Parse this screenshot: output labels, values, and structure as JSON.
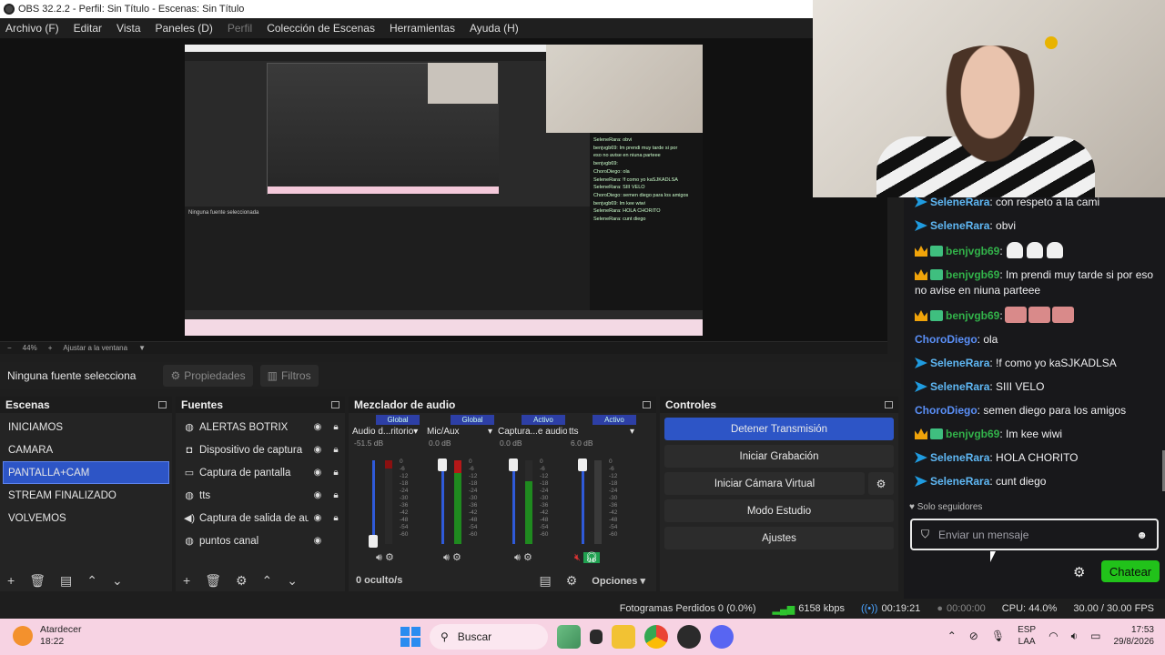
{
  "window": {
    "title": "OBS 32.2.2 - Perfil: Sin Título - Escenas: Sin Título"
  },
  "menu": [
    "Archivo (F)",
    "Editar",
    "Vista",
    "Paneles (D)",
    "Perfil",
    "Colección de Escenas",
    "Herramientas",
    "Ayuda (H)"
  ],
  "preview": {
    "zoom": "44%",
    "fit_label": "Ajustar a la ventana",
    "nested_no_source": "Ninguna fuente seleccionada",
    "mini_chat": [
      "SeleneRara: obvi",
      "benjvgb69: Im prendi muy tarde si por",
      "eso no avise en niuna parteee",
      "benjvgb69:",
      "ChoroDiego: ola",
      "SeleneRara: !f como yo kaSJKADLSA",
      "SeleneRara: SIII VELO",
      "ChoroDiego: semen diego para los amigos",
      "benjvgb69: Im kee wiwi",
      "SeleneRara: HOLA CHORITO",
      "SeleneRara: cunt diego"
    ]
  },
  "source_toolbar": {
    "no_source": "Ninguna fuente selecciona",
    "properties": "Propiedades",
    "filters": "Filtros"
  },
  "scenes": {
    "title": "Escenas",
    "items": [
      "INICIAMOS",
      "CAMARA",
      "PANTALLA+CAM",
      "STREAM FINALIZADO",
      "VOLVEMOS"
    ],
    "selected": "PANTALLA+CAM"
  },
  "sources": {
    "title": "Fuentes",
    "items": [
      {
        "icon": "globe-icon",
        "name": "ALERTAS BOTRIX"
      },
      {
        "icon": "camera-icon",
        "name": "Dispositivo de captura"
      },
      {
        "icon": "monitor-icon",
        "name": "Captura de pantalla"
      },
      {
        "icon": "globe-icon",
        "name": "tts"
      },
      {
        "icon": "speaker-icon",
        "name": "Captura de salida de audio"
      },
      {
        "icon": "globe-icon",
        "name": "puntos canal"
      }
    ]
  },
  "mixer": {
    "title": "Mezclador de audio",
    "channels": [
      {
        "tag": "Global",
        "name": "Audio d...ritorio",
        "db": "-51.5 dB"
      },
      {
        "tag": "Global",
        "name": "Mic/Aux",
        "db": "0.0 dB"
      },
      {
        "tag": "Activo",
        "name": "Captura...e audio",
        "db": "0.0 dB"
      },
      {
        "tag": "Activo",
        "name": "tts",
        "db": "6.0 dB"
      }
    ],
    "scale": [
      "0",
      "-6",
      "-12",
      "-18",
      "-24",
      "-30",
      "-36",
      "-42",
      "-48",
      "-54",
      "-60"
    ],
    "hidden": "0 oculto/s",
    "options": "Opciones"
  },
  "controls": {
    "title": "Controles",
    "stop_stream": "Detener Transmisión",
    "start_recording": "Iniciar Grabación",
    "start_virtual_cam": "Iniciar Cámara Virtual",
    "studio_mode": "Modo Estudio",
    "settings": "Ajustes"
  },
  "status": {
    "dropped_frames": "Fotogramas Perdidos 0 (0.0%)",
    "bitrate": "6158 kbps",
    "stream_time": "00:19:21",
    "rec_time": "00:00:00",
    "cpu": "CPU: 44.0%",
    "fps": "30.00 / 30.00 FPS"
  },
  "chat": {
    "messages": [
      {
        "badges": [
          "prime"
        ],
        "user": "SeleneRara",
        "color": "#5fb8f5",
        "text": "con respeto a la cami"
      },
      {
        "badges": [
          "prime"
        ],
        "user": "SeleneRara",
        "color": "#5fb8f5",
        "text": "obvi"
      },
      {
        "badges": [
          "crown",
          "sub"
        ],
        "user": "benjvgb69",
        "color": "#32b24a",
        "text": "",
        "emotes": "ghost"
      },
      {
        "badges": [
          "crown",
          "sub"
        ],
        "user": "benjvgb69",
        "color": "#32b24a",
        "text": "Im prendi muy tarde si por eso no avise en niuna parteee"
      },
      {
        "badges": [
          "crown",
          "sub"
        ],
        "user": "benjvgb69",
        "color": "#32b24a",
        "text": "",
        "emotes": "face"
      },
      {
        "badges": [],
        "user": "ChoroDiego",
        "color": "#5a8ff7",
        "text": "ola"
      },
      {
        "badges": [
          "prime"
        ],
        "user": "SeleneRara",
        "color": "#5fb8f5",
        "text": "!f como yo kaSJKADLSA"
      },
      {
        "badges": [
          "prime"
        ],
        "user": "SeleneRara",
        "color": "#5fb8f5",
        "text": "SIII VELO"
      },
      {
        "badges": [],
        "user": "ChoroDiego",
        "color": "#5a8ff7",
        "text": "semen diego para los amigos"
      },
      {
        "badges": [
          "crown",
          "sub"
        ],
        "user": "benjvgb69",
        "color": "#32b24a",
        "text": "Im kee wiwi"
      },
      {
        "badges": [
          "prime"
        ],
        "user": "SeleneRara",
        "color": "#5fb8f5",
        "text": "HOLA CHORITO"
      },
      {
        "badges": [
          "prime"
        ],
        "user": "SeleneRara",
        "color": "#5fb8f5",
        "text": "cunt diego"
      }
    ],
    "followers_only": "Solo seguidores",
    "placeholder": "Enviar un mensaje",
    "send": "Chatear"
  },
  "taskbar": {
    "weather_title": "Atardecer",
    "weather_time": "18:22",
    "search": "Buscar",
    "lang": "ESP",
    "layout": "LAA",
    "time": "17:53",
    "date": "29/8/2026"
  }
}
